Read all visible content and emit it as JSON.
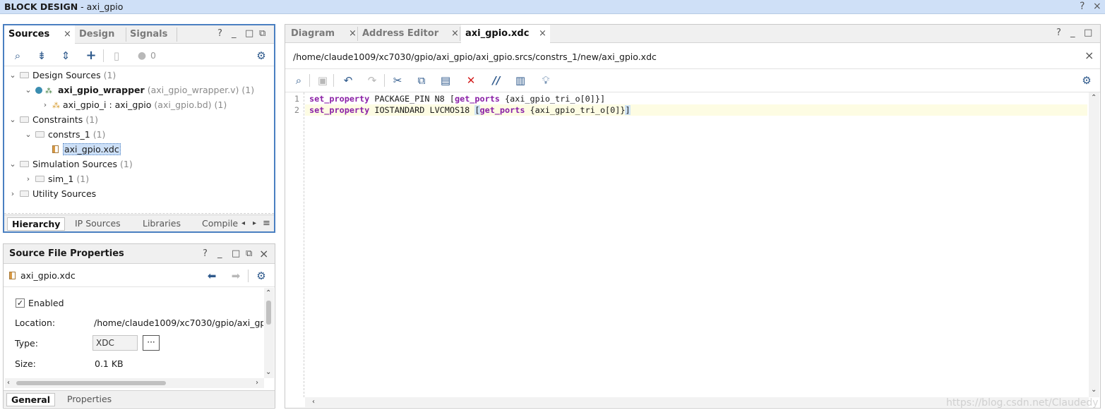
{
  "titlebar": {
    "title_bold": "BLOCK DESIGN",
    "title_rest": " - axi_gpio",
    "help": "?",
    "close": "×"
  },
  "sources_panel": {
    "tabs": [
      "Sources",
      "Design",
      "Signals"
    ],
    "ctrl": {
      "help": "?",
      "min": "_",
      "max": "□",
      "float": "⧉"
    },
    "toolbar": {
      "count": "0"
    },
    "tree": [
      {
        "label": "Design Sources",
        "count": "(1)"
      },
      {
        "label": "axi_gpio_wrapper",
        "detail": "(axi_gpio_wrapper.v)",
        "count": "(1)"
      },
      {
        "label": "axi_gpio_i : axi_gpio",
        "detail": "(axi_gpio.bd)",
        "count": "(1)"
      },
      {
        "label": "Constraints",
        "count": "(1)"
      },
      {
        "label": "constrs_1",
        "count": "(1)"
      },
      {
        "label": "axi_gpio.xdc"
      },
      {
        "label": "Simulation Sources",
        "count": "(1)"
      },
      {
        "label": "sim_1",
        "count": "(1)"
      },
      {
        "label": "Utility Sources"
      }
    ],
    "bottom_tabs": [
      "Hierarchy",
      "IP Sources",
      "Libraries",
      "Compile"
    ]
  },
  "props_panel": {
    "title": "Source File Properties",
    "filename": "axi_gpio.xdc",
    "enabled_label": "Enabled",
    "location_label": "Location:",
    "location_value": "/home/claude1009/xc7030/gpio/axi_gp",
    "type_label": "Type:",
    "type_value": "XDC",
    "type_more": "···",
    "size_label": "Size:",
    "size_value": "0.1 KB",
    "bottom_tabs": [
      "General",
      "Properties"
    ]
  },
  "editor": {
    "tabs": [
      "Diagram",
      "Address Editor",
      "axi_gpio.xdc"
    ],
    "path": "/home/claude1009/xc7030/gpio/axi_gpio/axi_gpio.srcs/constrs_1/new/axi_gpio.xdc",
    "lines": [
      {
        "num": "1",
        "kw1": "set_property",
        "mid": " PACKAGE_PIN N8 ",
        "b1": "[",
        "kw2": "get_ports",
        "tail": " {axi_gpio_tri_o[0]}",
        "b2": "]"
      },
      {
        "num": "2",
        "kw1": "set_property",
        "mid": " IOSTANDARD LVCMOS18 ",
        "b1": "[",
        "kw2": "get_ports",
        "tail": " {axi_gpio_tri_o[0]}",
        "b2": "]"
      }
    ]
  },
  "watermark": "https://blog.csdn.net/Claudedy"
}
